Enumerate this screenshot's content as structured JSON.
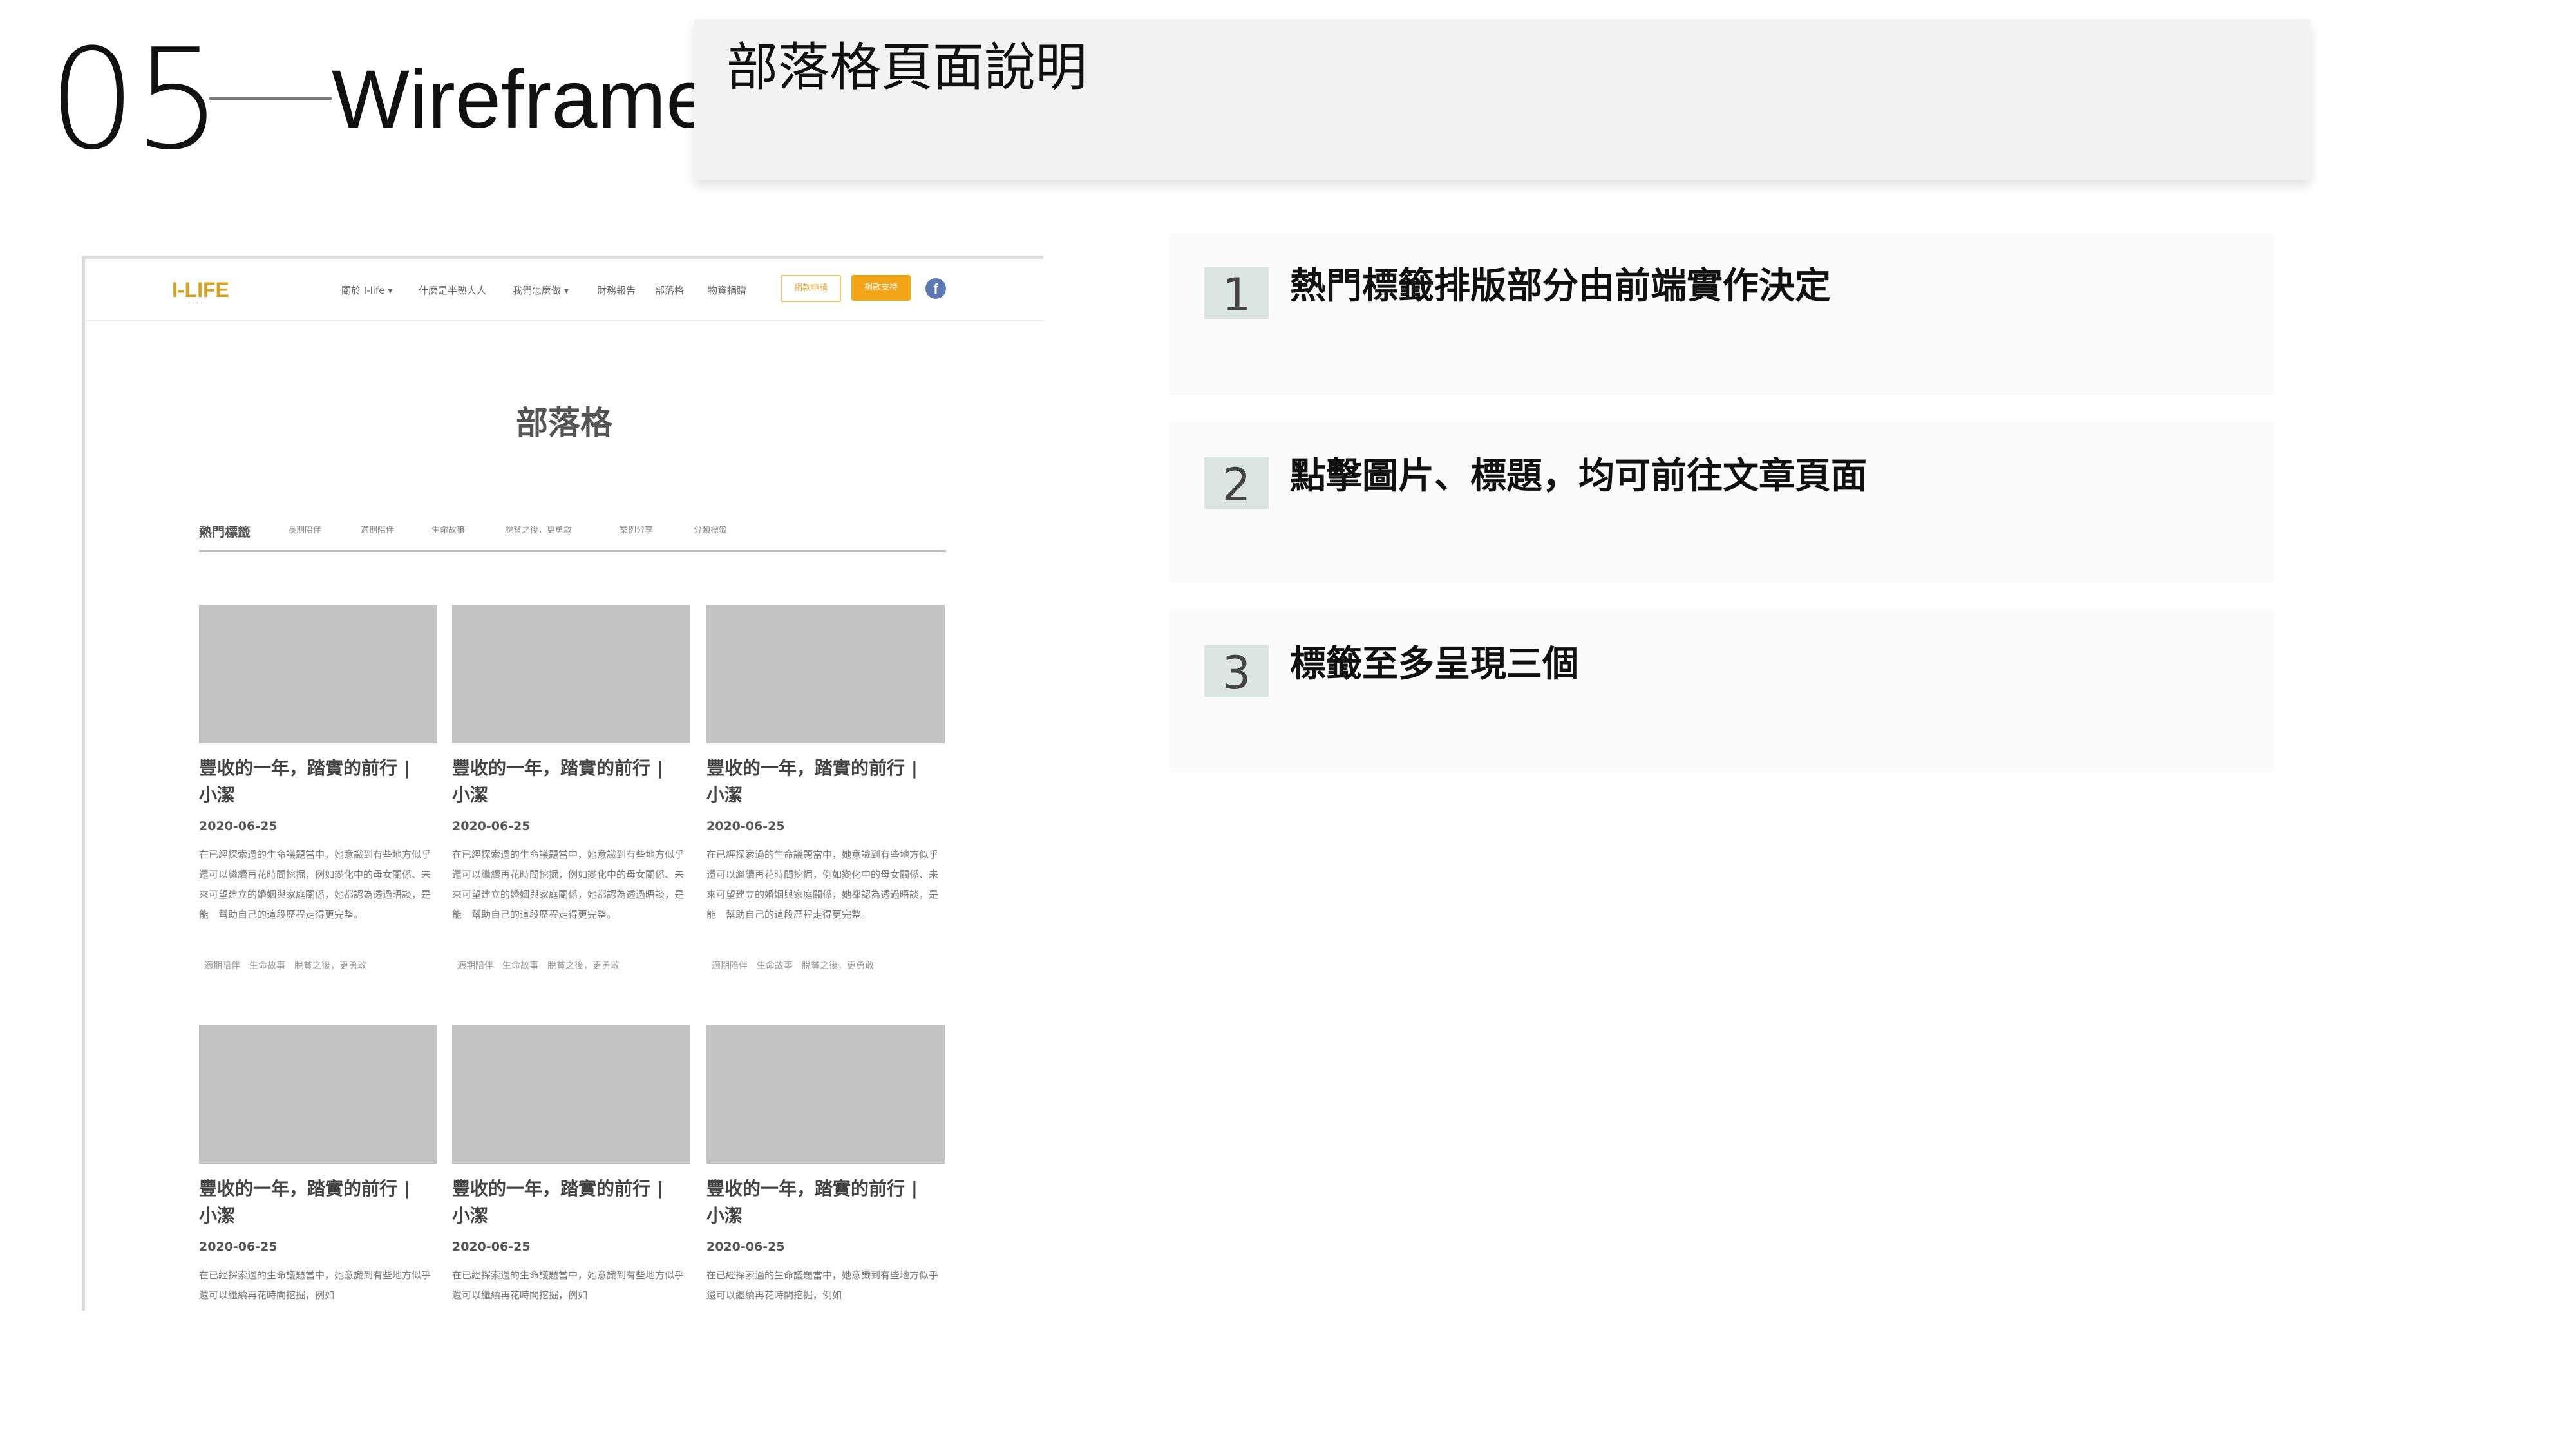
{
  "header": {
    "section_number": "05",
    "section_title": "Wireframe",
    "slide_title": "部落格頁面說明"
  },
  "wireframe": {
    "logo": "I-LIFE",
    "logo_sub": "· · · ·",
    "nav_items": [
      "關於 I-life ▾",
      "什麼是半熟大人",
      "我們怎麼做 ▾",
      "財務報告",
      "部落格",
      "物資捐贈"
    ],
    "btn_apply": "捐款申請",
    "btn_donate": "捐款支持",
    "fb_icon": "f",
    "page_heading": "部落格",
    "hot_tags_label": "熱門標籤",
    "hot_tags": [
      "長期陪伴",
      "適期陪伴",
      "生命故事",
      "脫貧之後，更勇敢",
      "案例分享",
      "分類標籤"
    ],
    "cards": [
      {
        "title": "豐收的一年，踏實的前行 | 小潔",
        "date": "2020-06-25",
        "excerpt": "在已經探索過的生命議題當中，她意識到有些地方似乎還可以繼續再花時間挖掘，例如變化中的母女關係、未來可望建立的婚姻與家庭關係，她都認為透過晤談，是能　幫助自己的這段歷程走得更完整。",
        "tags": "適期陪伴　生命故事　脫貧之後，更勇敢"
      },
      {
        "title": "豐收的一年，踏實的前行 | 小潔",
        "date": "2020-06-25",
        "excerpt": "在已經探索過的生命議題當中，她意識到有些地方似乎還可以繼續再花時間挖掘，例如變化中的母女關係、未來可望建立的婚姻與家庭關係，她都認為透過晤談，是能　幫助自己的這段歷程走得更完整。",
        "tags": "適期陪伴　生命故事　脫貧之後，更勇敢"
      },
      {
        "title": "豐收的一年，踏實的前行 | 小潔",
        "date": "2020-06-25",
        "excerpt": "在已經探索過的生命議題當中，她意識到有些地方似乎還可以繼續再花時間挖掘，例如變化中的母女關係、未來可望建立的婚姻與家庭關係，她都認為透過晤談，是能　幫助自己的這段歷程走得更完整。",
        "tags": "適期陪伴　生命故事　脫貧之後，更勇敢"
      },
      {
        "title": "豐收的一年，踏實的前行 | 小潔",
        "date": "2020-06-25",
        "excerpt": "在已經探索過的生命議題當中，她意識到有些地方似乎還可以繼續再花時間挖掘，例如"
      },
      {
        "title": "豐收的一年，踏實的前行 | 小潔",
        "date": "2020-06-25",
        "excerpt": "在已經探索過的生命議題當中，她意識到有些地方似乎還可以繼續再花時間挖掘，例如"
      },
      {
        "title": "豐收的一年，踏實的前行 | 小潔",
        "date": "2020-06-25",
        "excerpt": "在已經探索過的生命議題當中，她意識到有些地方似乎還可以繼續再花時間挖掘，例如"
      }
    ]
  },
  "notes": [
    {
      "number": "1",
      "text": "熱門標籤排版部分由前端實作決定"
    },
    {
      "number": "2",
      "text": "點擊圖片、標題，均可前往文章頁面"
    },
    {
      "number": "3",
      "text": "標籤至多呈現三個"
    }
  ]
}
